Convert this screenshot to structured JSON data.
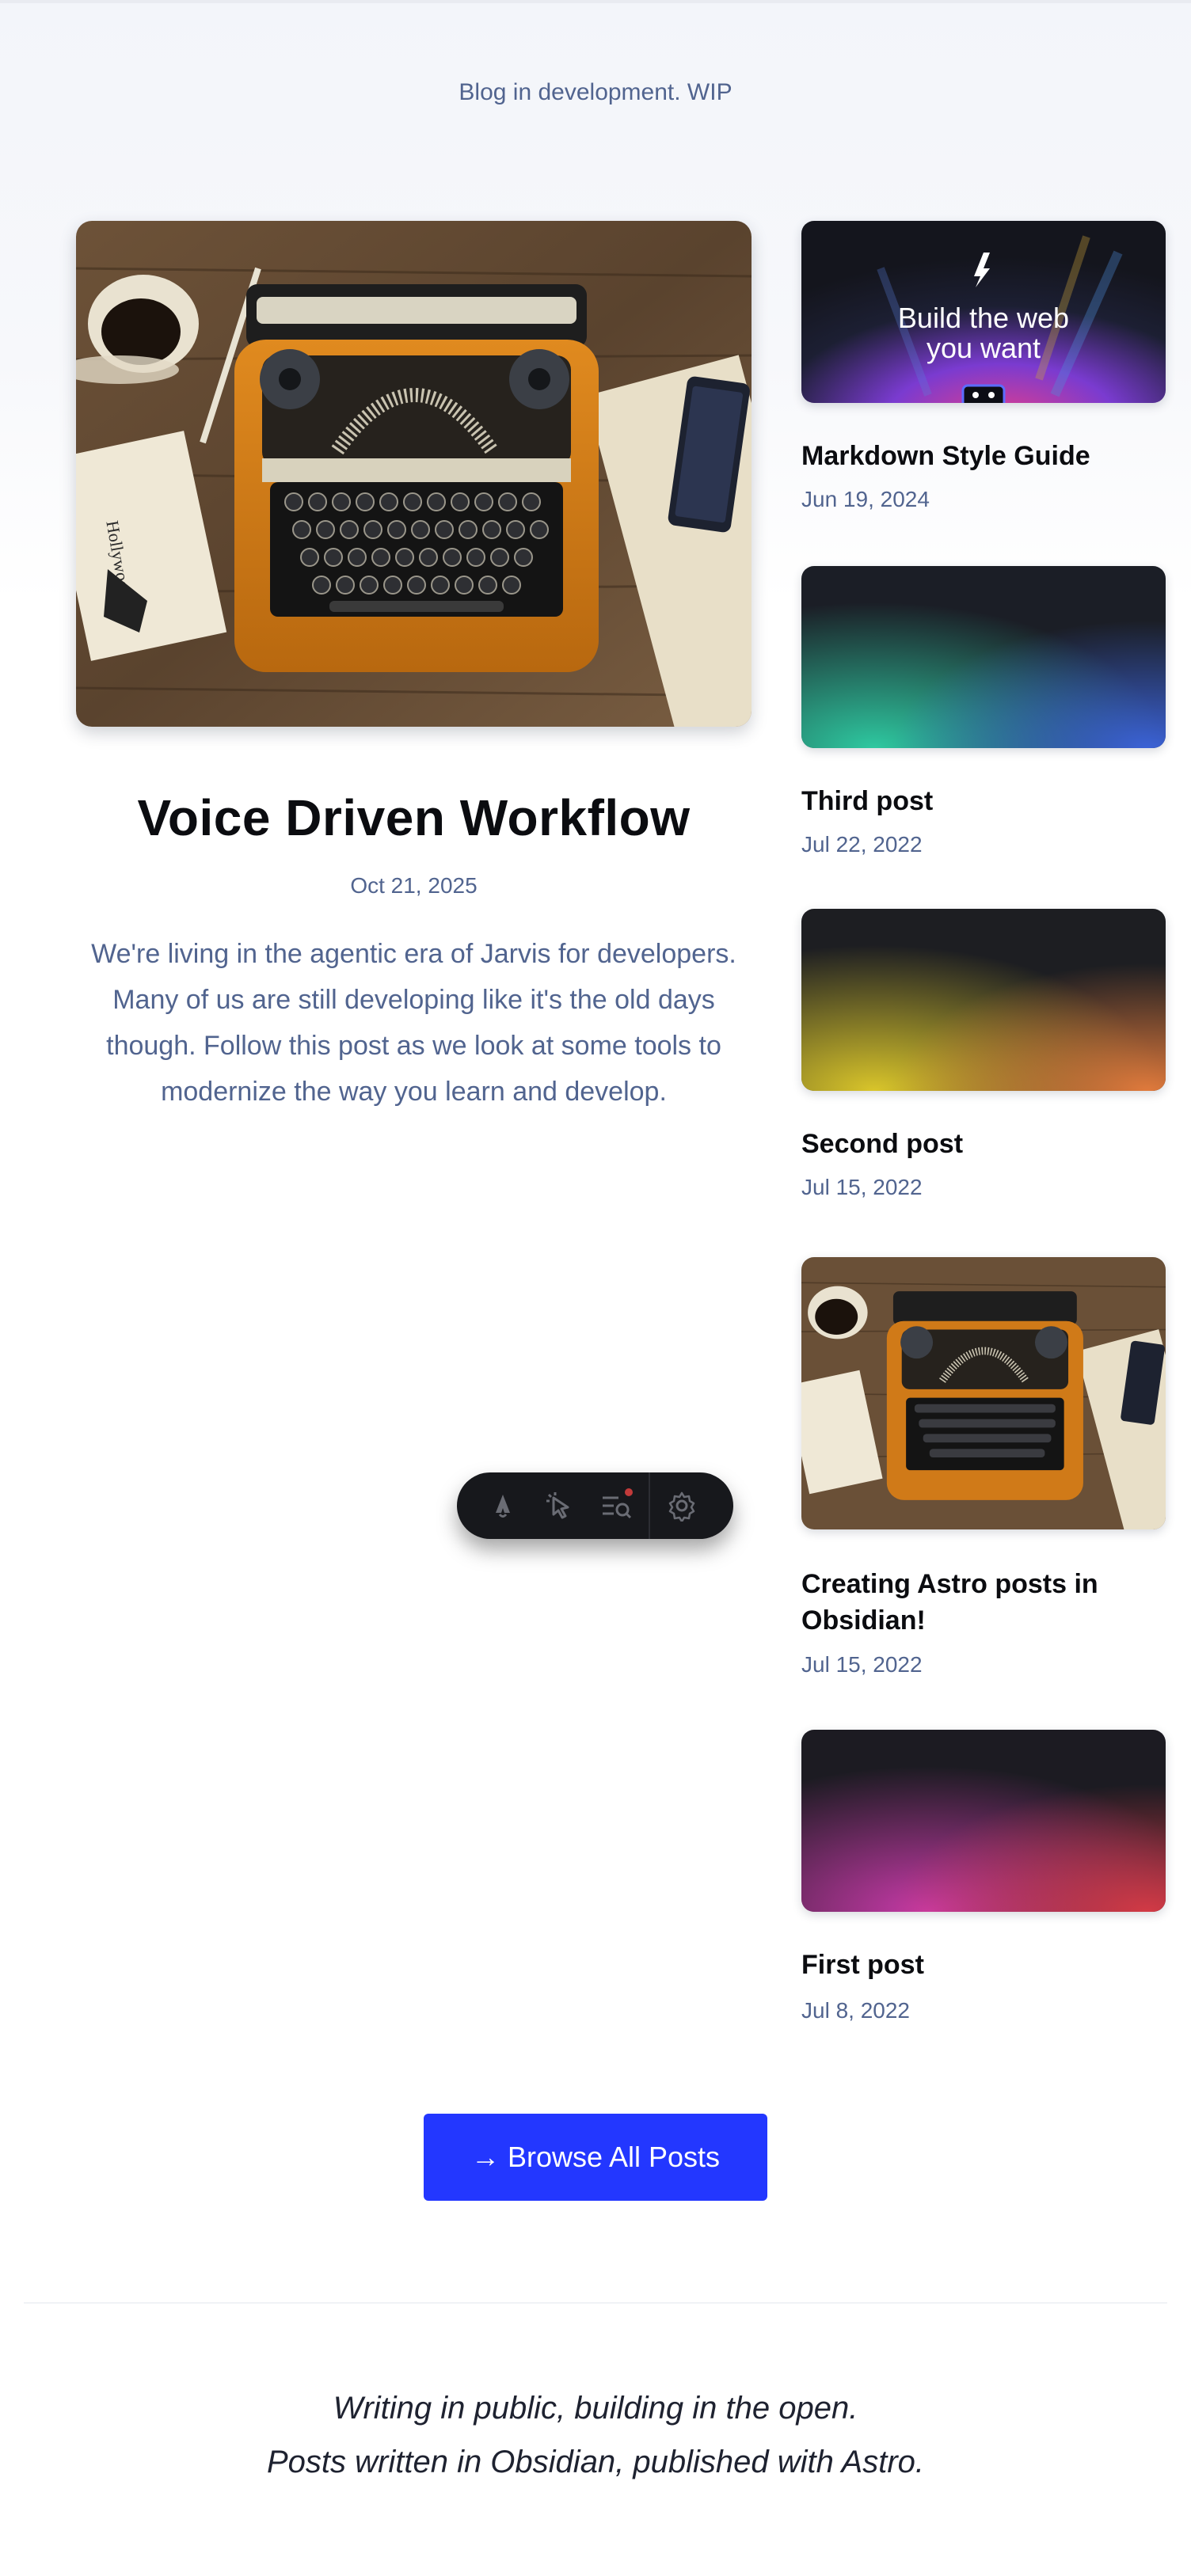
{
  "header": {
    "note": "Blog in development. WIP"
  },
  "hero": {
    "title": "Voice Driven Workflow",
    "date": "Oct 21, 2025",
    "description": "We're living in the agentic era of Jarvis for developers. Many of us are still developing like it's the old days though. Follow this post as we look at some tools to modernize the way you learn and develop.",
    "image": "typewriter-photo"
  },
  "posts": [
    {
      "title": "Markdown Style Guide",
      "date": "Jun 19, 2024",
      "image": "astro-banner",
      "banner_text": "Build the web you want"
    },
    {
      "title": "Third post",
      "date": "Jul 22, 2022",
      "image": "teal-blue-gradient"
    },
    {
      "title": "Second post",
      "date": "Jul 15, 2022",
      "image": "yellow-orange-gradient"
    },
    {
      "title": "Creating Astro posts in Obsidian!",
      "date": "Jul 15, 2022",
      "image": "typewriter-photo"
    },
    {
      "title": "First post",
      "date": "Jul 8, 2022",
      "image": "magenta-red-gradient"
    }
  ],
  "dev_toolbar": {
    "icons": [
      "astro-logo-icon",
      "cursor-inspect-icon",
      "audit-list-icon",
      "settings-gear-icon"
    ]
  },
  "browse": {
    "label": "→ Browse All Posts",
    "color": "#2337ff"
  },
  "footer": {
    "line1": "Writing in public, building in the open.",
    "line2": "Posts written in Obsidian, published with Astro."
  },
  "colors": {
    "accent": "#2337ff",
    "muted_text": "#51648f",
    "heading": "#0b0c10"
  }
}
